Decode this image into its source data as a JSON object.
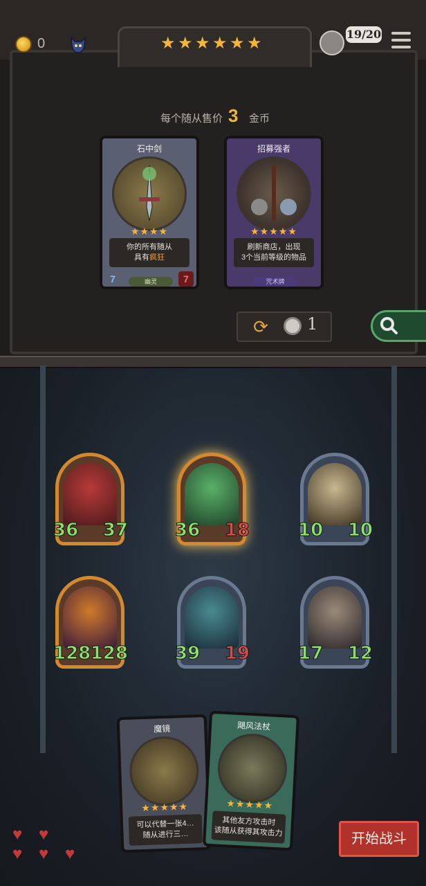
{
  "topbar": {
    "gold": "0",
    "stars": [
      "★",
      "★",
      "★",
      "★",
      "★",
      "★"
    ],
    "turn": "19/20",
    "icons": {
      "gold": "coin-icon",
      "mascot": "cat-icon",
      "menu": "hamburger-icon",
      "avatar": "player-avatar"
    }
  },
  "shop": {
    "sell_label": "每个随从售价",
    "sell_amount": "3",
    "sell_unit": "金币",
    "cards": [
      {
        "title": "石中剑",
        "stars": "★★★★",
        "desc_line1": "你的所有随从",
        "desc_line2_prefix": "具有",
        "desc_line2_key": "疯狂",
        "tag": "幽灵",
        "attack": "7",
        "health": "7"
      },
      {
        "title": "招募强者",
        "stars": "★★★★★",
        "desc_line1": "刷新商店，出现",
        "desc_line2_prefix": "3个当前等级的物品",
        "desc_line2_key": "",
        "tag": "咒术牌",
        "attack": "",
        "health": ""
      }
    ],
    "reroll_cost": "1"
  },
  "board": {
    "minions": [
      {
        "name": "red-dragon",
        "attack": "36",
        "health": "37",
        "frame": "gold"
      },
      {
        "name": "green-dragon",
        "attack": "36",
        "health": "18",
        "frame": "gold"
      },
      {
        "name": "mummy-priest",
        "attack": "10",
        "health": "10",
        "frame": "silver"
      },
      {
        "name": "pumpkin-stack",
        "attack": "128",
        "health": "128",
        "frame": "gold"
      },
      {
        "name": "horned-beast",
        "attack": "39",
        "health": "19",
        "frame": "silver"
      },
      {
        "name": "winged-demon",
        "attack": "17",
        "health": "12",
        "frame": "silver"
      }
    ]
  },
  "hand": {
    "cards": [
      {
        "title": "魔镜",
        "stars": "★★★★★",
        "desc_line1": "可以代替一张4…",
        "desc_line2": "随从进行三…"
      },
      {
        "title": "飓风法杖",
        "stars": "★★★★★",
        "desc_line1": "其他友方攻击时",
        "desc_line2": "该随从获得其攻击力"
      }
    ]
  },
  "lives": {
    "filled": 3,
    "total": 5
  },
  "start_label": "开始战斗"
}
